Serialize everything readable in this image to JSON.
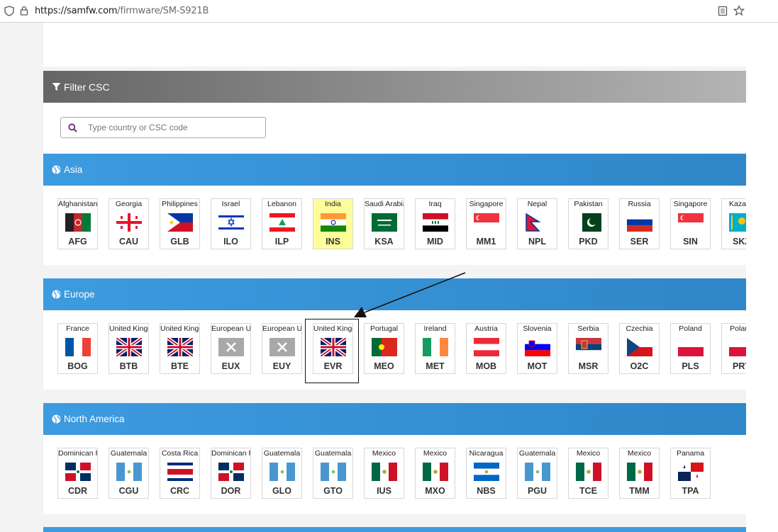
{
  "browser": {
    "url_host": "https://samfw.com",
    "url_path": "/firmware/SM-S921B"
  },
  "filter": {
    "title": "Filter CSC",
    "search_placeholder": "Type country or CSC code"
  },
  "regions": [
    {
      "name": "Asia",
      "tiles": [
        {
          "country": "Afghanistan",
          "code": "AFG",
          "flag": "af"
        },
        {
          "country": "Georgia",
          "code": "CAU",
          "flag": "ge"
        },
        {
          "country": "Philippines",
          "code": "GLB",
          "flag": "ph"
        },
        {
          "country": "Israel",
          "code": "ILO",
          "flag": "il"
        },
        {
          "country": "Lebanon",
          "code": "ILP",
          "flag": "lb"
        },
        {
          "country": "India",
          "code": "INS",
          "flag": "in",
          "highlight": true
        },
        {
          "country": "Saudi Arabia",
          "code": "KSA",
          "flag": "sa"
        },
        {
          "country": "Iraq",
          "code": "MID",
          "flag": "iq"
        },
        {
          "country": "Singapore",
          "code": "MM1",
          "flag": "sg"
        },
        {
          "country": "Nepal",
          "code": "NPL",
          "flag": "np"
        },
        {
          "country": "Pakistan",
          "code": "PKD",
          "flag": "pk"
        },
        {
          "country": "Russia",
          "code": "SER",
          "flag": "ru"
        },
        {
          "country": "Singapore",
          "code": "SIN",
          "flag": "sg"
        },
        {
          "country": "Kazakh",
          "code": "SKZ",
          "flag": "kz"
        }
      ]
    },
    {
      "name": "Europe",
      "tiles": [
        {
          "country": "France",
          "code": "BOG",
          "flag": "fr"
        },
        {
          "country": "United Kingdom",
          "code": "BTB",
          "flag": "gb"
        },
        {
          "country": "United Kingdom",
          "code": "BTE",
          "flag": "gb"
        },
        {
          "country": "European Union",
          "code": "EUX",
          "flag": "eu"
        },
        {
          "country": "European Union",
          "code": "EUY",
          "flag": "eu"
        },
        {
          "country": "United Kingdom",
          "code": "EVR",
          "flag": "gb"
        },
        {
          "country": "Portugal",
          "code": "MEO",
          "flag": "pt"
        },
        {
          "country": "Ireland",
          "code": "MET",
          "flag": "ie"
        },
        {
          "country": "Austria",
          "code": "MOB",
          "flag": "at"
        },
        {
          "country": "Slovenia",
          "code": "MOT",
          "flag": "si"
        },
        {
          "country": "Serbia",
          "code": "MSR",
          "flag": "rs"
        },
        {
          "country": "Czechia",
          "code": "O2C",
          "flag": "cz"
        },
        {
          "country": "Poland",
          "code": "PLS",
          "flag": "pl"
        },
        {
          "country": "Poland",
          "code": "PRT",
          "flag": "pl"
        }
      ]
    },
    {
      "name": "North America",
      "tiles": [
        {
          "country": "Dominican Republic",
          "code": "CDR",
          "flag": "do"
        },
        {
          "country": "Guatemala",
          "code": "CGU",
          "flag": "gt"
        },
        {
          "country": "Costa Rica",
          "code": "CRC",
          "flag": "cr"
        },
        {
          "country": "Dominican Republic",
          "code": "DOR",
          "flag": "do"
        },
        {
          "country": "Guatemala",
          "code": "GLO",
          "flag": "gt"
        },
        {
          "country": "Guatemala",
          "code": "GTO",
          "flag": "gt"
        },
        {
          "country": "Mexico",
          "code": "IUS",
          "flag": "mx"
        },
        {
          "country": "Mexico",
          "code": "MXO",
          "flag": "mx"
        },
        {
          "country": "Nicaragua",
          "code": "NBS",
          "flag": "ni"
        },
        {
          "country": "Guatemala",
          "code": "PGU",
          "flag": "gt"
        },
        {
          "country": "Mexico",
          "code": "TCE",
          "flag": "mx"
        },
        {
          "country": "Mexico",
          "code": "TMM",
          "flag": "mx"
        },
        {
          "country": "Panama",
          "code": "TPA",
          "flag": "pa"
        }
      ]
    }
  ],
  "colors": {
    "region_header": "#3d9be0",
    "filter_header": "#707070",
    "highlight": "#fdfd9a"
  },
  "annotation": {
    "target_code": "EVR"
  }
}
